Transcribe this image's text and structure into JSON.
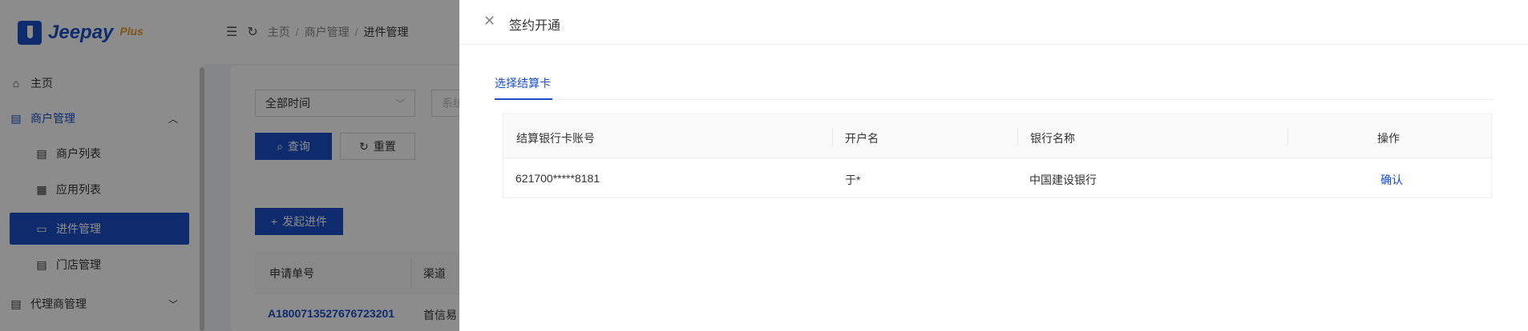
{
  "sidebar": {
    "logo_text": "Jeepay",
    "logo_plus": "Plus",
    "items": [
      {
        "label": "主页",
        "icon": "home-icon"
      },
      {
        "label": "商户管理",
        "icon": "shop-icon"
      },
      {
        "label": "商户列表",
        "icon": "list-icon"
      },
      {
        "label": "应用列表",
        "icon": "grid-icon"
      },
      {
        "label": "进件管理",
        "icon": "calendar-icon"
      },
      {
        "label": "门店管理",
        "icon": "list-icon"
      },
      {
        "label": "代理商管理",
        "icon": "shop-icon"
      }
    ]
  },
  "breadcrumb": {
    "home": "主页",
    "merchant": "商户管理",
    "current": "进件管理"
  },
  "filters": {
    "time_select": "全部时间",
    "second_placeholder": "系统"
  },
  "buttons": {
    "search": "查询",
    "reset": "重置",
    "create": "发起进件"
  },
  "behind_table": {
    "headers": [
      "申请单号",
      "渠道"
    ],
    "row": {
      "order_no": "A1800713527676723201",
      "channel": "首信易"
    }
  },
  "drawer": {
    "title": "签约开通",
    "tab": "选择结算卡",
    "table": {
      "headers": [
        "结算银行卡账号",
        "开户名",
        "银行名称",
        "操作"
      ],
      "rows": [
        {
          "account": "621700*****8181",
          "name": "于*",
          "bank": "中国建设银行",
          "action": "确认"
        }
      ]
    }
  },
  "colors": {
    "primary": "#1a4fc9",
    "accent": "#e89a2c"
  }
}
